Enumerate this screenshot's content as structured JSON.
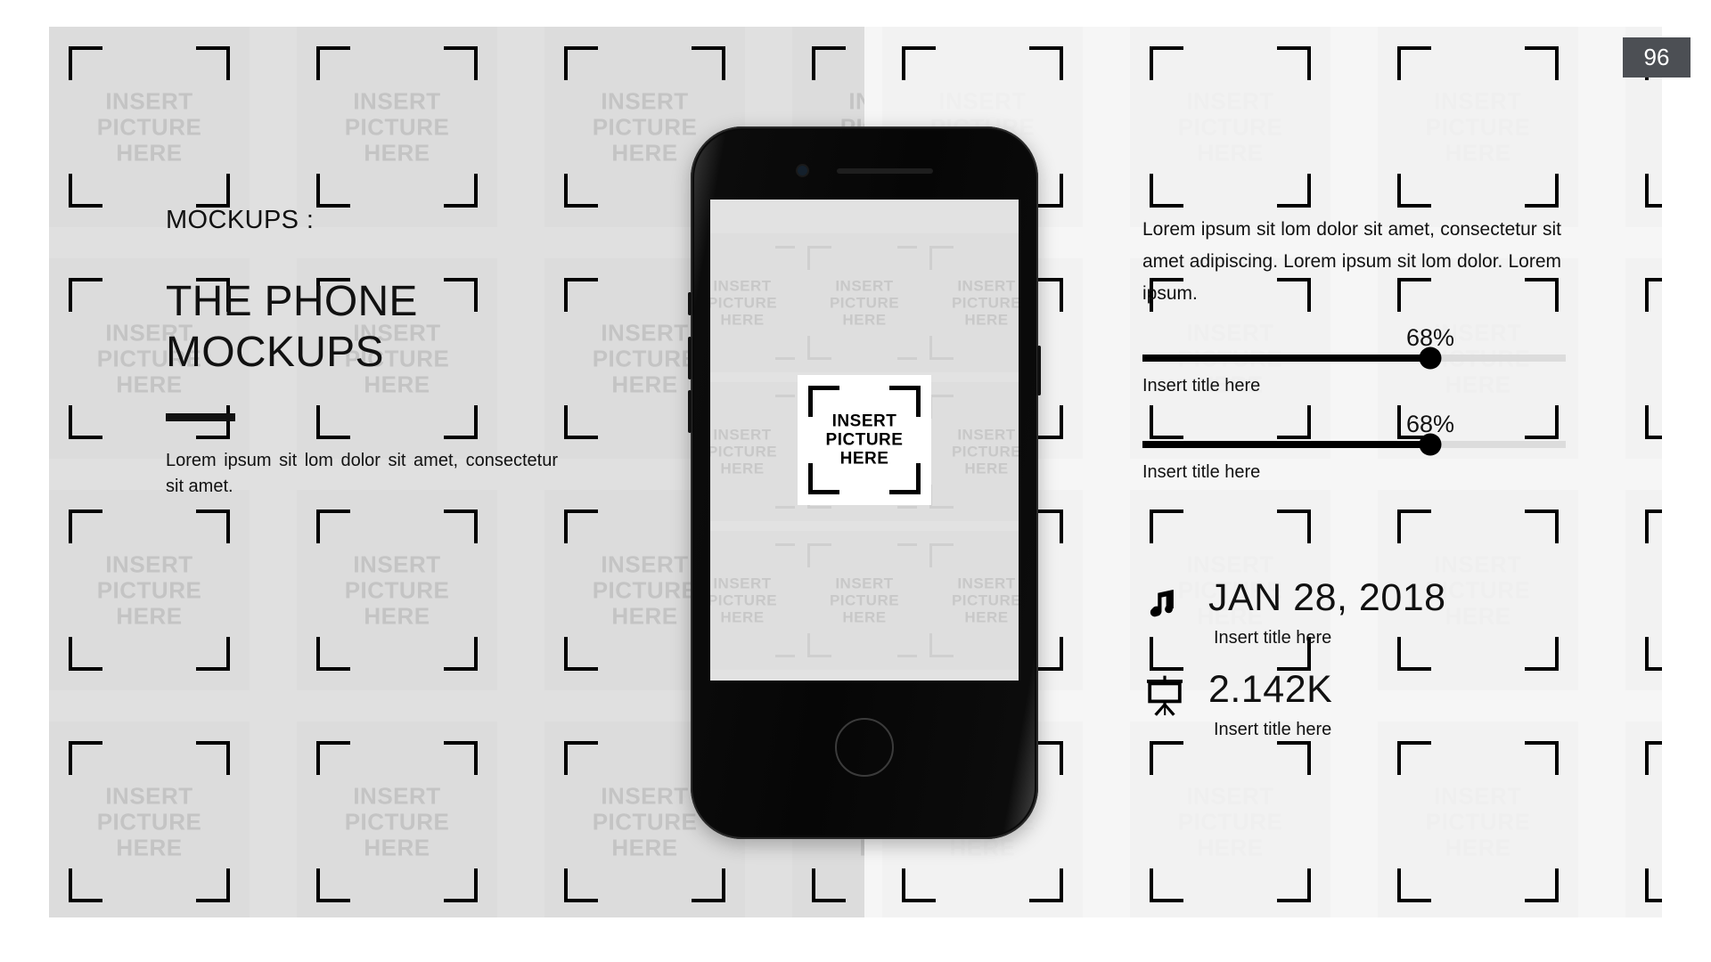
{
  "page": {
    "number": "96"
  },
  "left": {
    "kicker": "MOCKUPS :",
    "headline": "THE PHONE MOCKUPS",
    "paragraph": "Lorem ipsum sit lom dolor sit amet, consectetur sit amet."
  },
  "right": {
    "paragraph": "Lorem ipsum sit lom dolor sit amet, consectetur sit amet adipiscing. Lorem ipsum sit lom dolor. Lorem ipsum.",
    "sliders": [
      {
        "percent_label": "68%",
        "value": 68,
        "label": "Insert title here"
      },
      {
        "percent_label": "68%",
        "value": 68,
        "label": "Insert title here"
      }
    ],
    "stats": [
      {
        "icon": "music-note-icon",
        "value": "JAN 28, 2018",
        "label": "Insert title here"
      },
      {
        "icon": "presentation-easel-icon",
        "value": "2.142K",
        "label": "Insert title here"
      }
    ]
  },
  "placeholder": {
    "line1": "INSERT",
    "line2": "PICTURE",
    "line3": "HERE"
  },
  "colors": {
    "left_panel_bg": "#e0e0e0",
    "right_panel_bg": "#f6f6f6",
    "accent": "#000000",
    "badge_bg": "#4c4f54",
    "slider_track": "#dcdcdc"
  }
}
